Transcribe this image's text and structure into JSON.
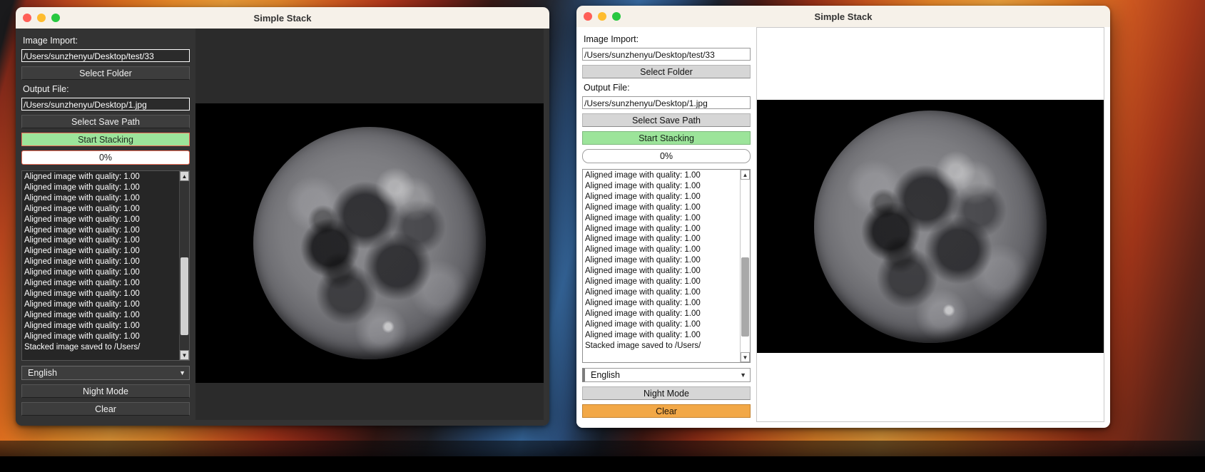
{
  "desktop": {
    "wallpaper_description": "colorful abstract orange and blue stripes"
  },
  "windows": [
    {
      "id": "dark",
      "theme": "dark",
      "title": "Simple Stack",
      "traffic_lights": {
        "close": "close-button",
        "minimize": "minimize-button",
        "zoom": "zoom-button",
        "close_color": "#ff5f57",
        "minimize_color": "#febc2e",
        "zoom_color": "#28c840"
      },
      "panel": {
        "image_import_label": "Image Import:",
        "image_import_value": "/Users/sunzhenyu/Desktop/test/33",
        "image_import_placeholder": "/Users/sunzhenyu/Desktop/test/33",
        "select_folder_label": "Select Folder",
        "output_file_label": "Output File:",
        "output_file_value": "/Users/sunzhenyu/Desktop/1.jpg",
        "output_file_placeholder": "/Users/sunzhenyu/Desktop/1.jpg",
        "select_save_path_label": "Select Save Path",
        "start_stacking_label": "Start Stacking",
        "start_stacking_color": "#9ce49a",
        "progress_value": "0%",
        "progress_percent": 0,
        "log_lines": [
          "Aligned image with quality: 1.00",
          "Aligned image with quality: 1.00",
          "Aligned image with quality: 1.00",
          "Aligned image with quality: 1.00",
          "Aligned image with quality: 1.00",
          "Aligned image with quality: 1.00",
          "Aligned image with quality: 1.00",
          "Aligned image with quality: 1.00",
          "Aligned image with quality: 1.00",
          "Aligned image with quality: 1.00",
          "Aligned image with quality: 1.00",
          "Aligned image with quality: 1.00",
          "Aligned image with quality: 1.00",
          "Aligned image with quality: 1.00",
          "Aligned image with quality: 1.00",
          "Aligned image with quality: 1.00",
          "Stacked image saved to /Users/"
        ],
        "language_value": "English",
        "night_mode_label": "Night Mode",
        "clear_label": "Clear",
        "clear_color": "#3d3d3d"
      },
      "preview": {
        "alt": "stacked photograph of the full moon on black sky"
      }
    },
    {
      "id": "light",
      "theme": "light",
      "title": "Simple Stack",
      "traffic_lights": {
        "close": "close-button",
        "minimize": "minimize-button",
        "zoom": "zoom-button",
        "close_color": "#ff5f57",
        "minimize_color": "#febc2e",
        "zoom_color": "#28c840"
      },
      "panel": {
        "image_import_label": "Image Import:",
        "image_import_value": "/Users/sunzhenyu/Desktop/test/33",
        "image_import_placeholder": "/Users/sunzhenyu/Desktop/test/33",
        "select_folder_label": "Select Folder",
        "output_file_label": "Output File:",
        "output_file_value": "/Users/sunzhenyu/Desktop/1.jpg",
        "output_file_placeholder": "/Users/sunzhenyu/Desktop/1.jpg",
        "select_save_path_label": "Select Save Path",
        "start_stacking_label": "Start Stacking",
        "start_stacking_color": "#9ce49a",
        "progress_value": "0%",
        "progress_percent": 0,
        "log_lines": [
          "Aligned image with quality: 1.00",
          "Aligned image with quality: 1.00",
          "Aligned image with quality: 1.00",
          "Aligned image with quality: 1.00",
          "Aligned image with quality: 1.00",
          "Aligned image with quality: 1.00",
          "Aligned image with quality: 1.00",
          "Aligned image with quality: 1.00",
          "Aligned image with quality: 1.00",
          "Aligned image with quality: 1.00",
          "Aligned image with quality: 1.00",
          "Aligned image with quality: 1.00",
          "Aligned image with quality: 1.00",
          "Aligned image with quality: 1.00",
          "Aligned image with quality: 1.00",
          "Aligned image with quality: 1.00",
          "Stacked image saved to /Users/"
        ],
        "language_value": "English",
        "night_mode_label": "Night Mode",
        "clear_label": "Clear",
        "clear_color": "#f2a847"
      },
      "preview": {
        "alt": "stacked photograph of the full moon on black sky"
      }
    }
  ],
  "icons": {
    "scroll_up": "▲",
    "scroll_down": "▼",
    "chevron_down": "▼"
  }
}
